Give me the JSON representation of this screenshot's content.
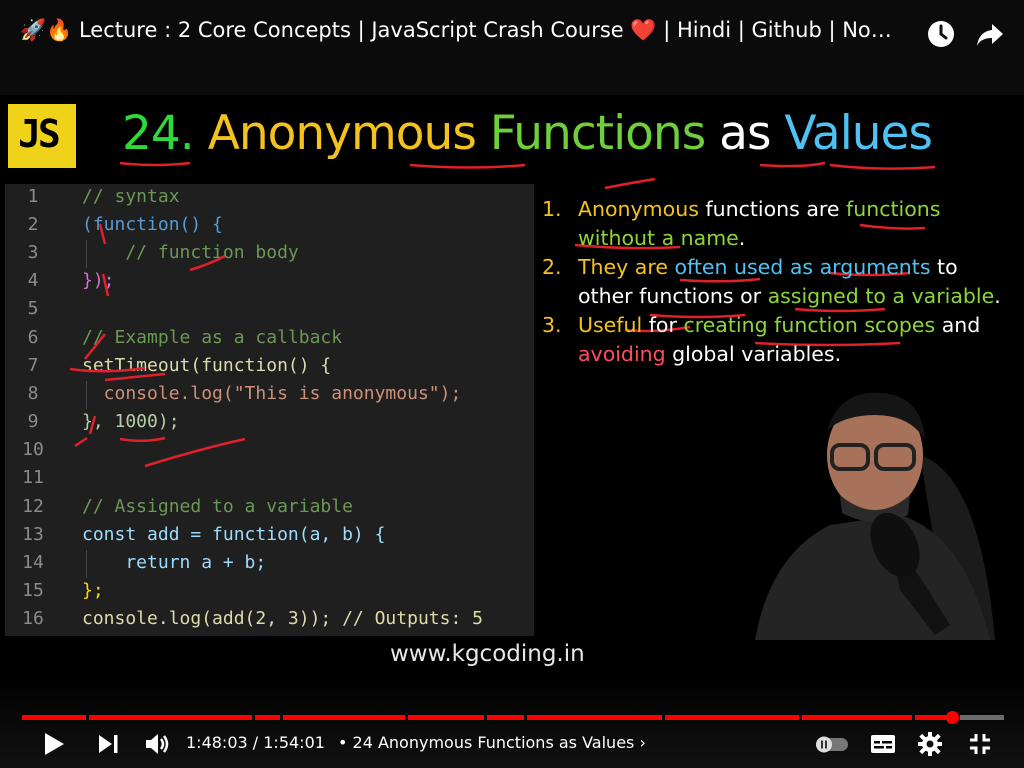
{
  "header": {
    "title": "🚀🔥 Lecture : 2 Core Concepts | JavaScript Crash Course ❤️  | Hindi | Github | No…"
  },
  "slide": {
    "logo_text": "JS",
    "headline": {
      "number": "24.",
      "word1": "Anonymous",
      "word2": "Functions",
      "word3": "as",
      "word4": "Values"
    },
    "code_lines": [
      {
        "n": "1",
        "text": "// syntax"
      },
      {
        "n": "2",
        "text": "(function() {"
      },
      {
        "n": "3",
        "text": "    // function body"
      },
      {
        "n": "4",
        "text": "});"
      },
      {
        "n": "5",
        "text": ""
      },
      {
        "n": "6",
        "text": "// Example as a callback"
      },
      {
        "n": "7",
        "text": "setTimeout(function() {"
      },
      {
        "n": "8",
        "text": "  console.log(\"This is anonymous\");"
      },
      {
        "n": "9",
        "text": "}, 1000);"
      },
      {
        "n": "10",
        "text": ""
      },
      {
        "n": "11",
        "text": ""
      },
      {
        "n": "12",
        "text": "// Assigned to a variable"
      },
      {
        "n": "13",
        "text": "const add = function(a, b) {"
      },
      {
        "n": "14",
        "text": "    return a + b;"
      },
      {
        "n": "15",
        "text": "};"
      },
      {
        "n": "16",
        "text": "console.log(add(2, 3)); // Outputs: 5"
      }
    ],
    "points": [
      {
        "num": "1.",
        "parts": [
          "Anonymous",
          " functions are ",
          "functions",
          " ",
          "without a name",
          "."
        ]
      },
      {
        "num": "2.",
        "parts": [
          "They are ",
          "often used as arguments",
          " to other functions or ",
          "assigned to a variable",
          "."
        ]
      },
      {
        "num": "3.",
        "parts": [
          "Useful",
          " for ",
          "creating function scopes",
          " and ",
          "avoiding",
          " global variables."
        ]
      }
    ],
    "website": "www.kgcoding.in"
  },
  "player": {
    "current_time": "1:48:03",
    "separator": " / ",
    "duration": "1:54:01",
    "chapter": "• 24 Anonymous Functions as Values ›",
    "progress_fraction": 0.947
  },
  "icons": [
    "watch-later-icon",
    "share-icon",
    "play-icon",
    "next-icon",
    "volume-icon",
    "autoplay-toggle-icon",
    "subtitles-icon",
    "settings-icon",
    "fullscreen-icon"
  ]
}
